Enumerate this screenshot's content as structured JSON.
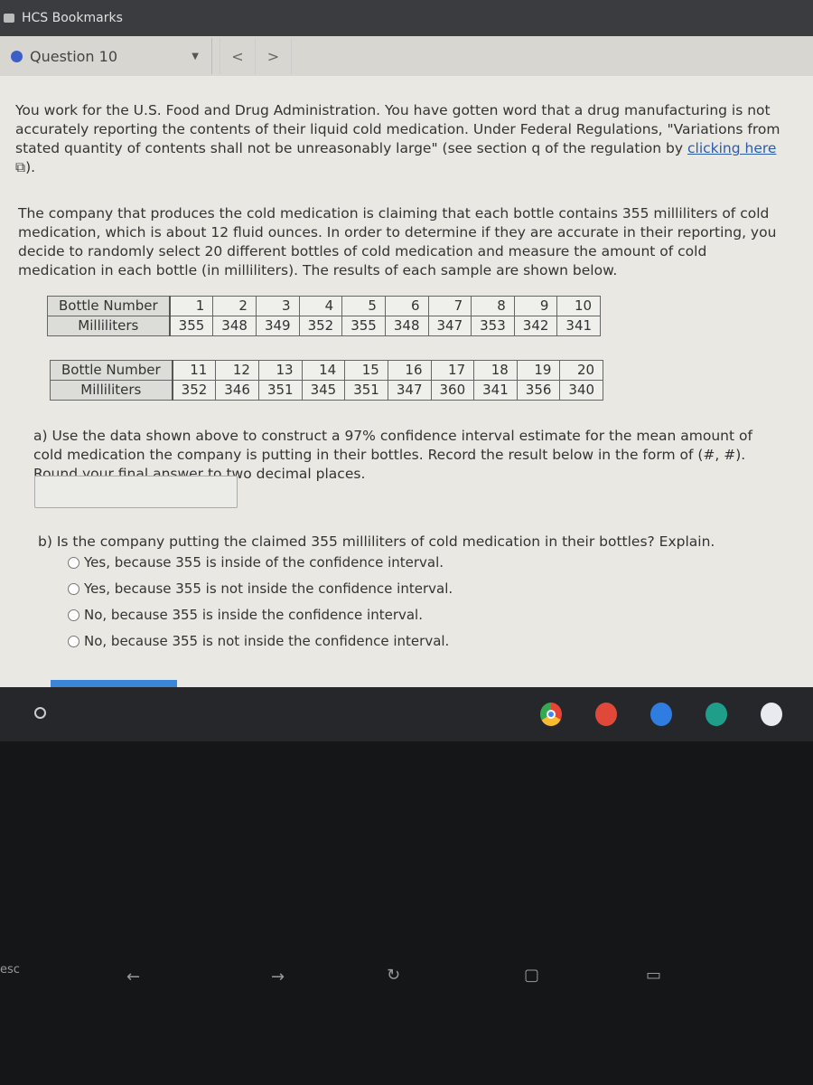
{
  "bookmarks": {
    "label": "HCS Bookmarks"
  },
  "question_bar": {
    "label": "Question 10",
    "prev": "<",
    "next": ">"
  },
  "intro": {
    "text": "You work for the U.S. Food and Drug Administration. You have gotten word that a drug manufacturing is not accurately reporting the contents of their liquid cold medication. Under Federal Regulations, \"Variations from stated quantity of contents shall not be unreasonably large\" (see section q of the regulation by ",
    "link": "clicking here",
    "after": ")."
  },
  "setup": "The company that produces the cold medication is claiming that each bottle contains 355 milliliters of cold medication, which is about 12 fluid ounces. In order to determine if they are accurate in their reporting, you decide to randomly select 20 different bottles of cold medication and measure the amount of cold medication in each bottle (in milliliters). The results of each sample are shown below.",
  "tables": [
    {
      "row_labels": [
        "Bottle Number",
        "Milliliters"
      ],
      "numbers": [
        "1",
        "2",
        "3",
        "4",
        "5",
        "6",
        "7",
        "8",
        "9",
        "10"
      ],
      "values": [
        "355",
        "348",
        "349",
        "352",
        "355",
        "348",
        "347",
        "353",
        "342",
        "341"
      ]
    },
    {
      "row_labels": [
        "Bottle Number",
        "Milliliters"
      ],
      "numbers": [
        "11",
        "12",
        "13",
        "14",
        "15",
        "16",
        "17",
        "18",
        "19",
        "20"
      ],
      "values": [
        "352",
        "346",
        "351",
        "345",
        "351",
        "347",
        "360",
        "341",
        "356",
        "340"
      ]
    }
  ],
  "part_a": "a) Use the data shown above to construct a 97% confidence interval estimate for the mean amount of cold medication the company is putting in their bottles. Record the result below in the form of (#, #). Round your final answer to two decimal places.",
  "answer_value": "",
  "part_b": {
    "question": "b) Is the company putting the claimed 355 milliliters of cold medication in their bottles? Explain.",
    "options": [
      "Yes, because 355 is inside of the confidence interval.",
      "Yes, because 355 is not inside the confidence interval.",
      "No, because 355 is inside the confidence interval.",
      "No, because 355 is not inside the confidence interval."
    ]
  },
  "shelf": {
    "apps": [
      {
        "icon": "chrome-icon",
        "color": "#4285f4"
      },
      {
        "icon": "canvas-icon",
        "color": "#e0483a"
      },
      {
        "icon": "notes-icon",
        "color": "#2f7de0"
      },
      {
        "icon": "classroom-icon",
        "color": "#1f9e8a"
      },
      {
        "icon": "docs-icon",
        "color": "#e8eaf0"
      }
    ]
  },
  "keyboard": {
    "esc": "esc"
  }
}
